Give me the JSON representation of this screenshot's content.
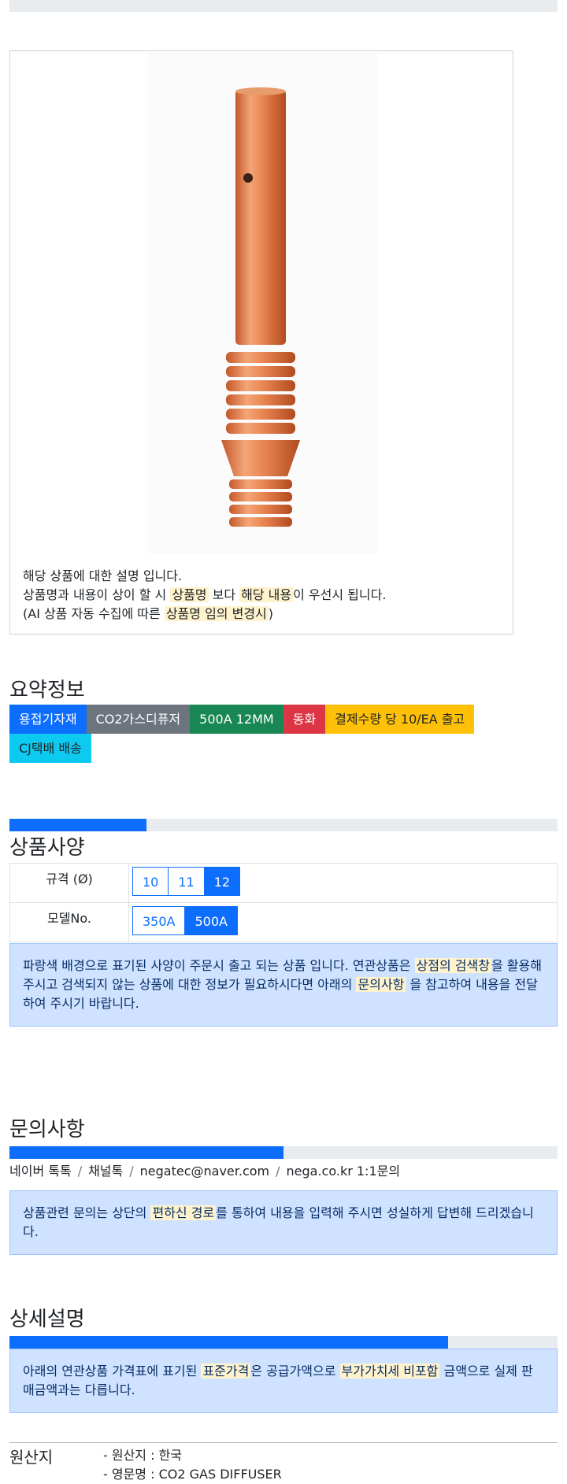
{
  "product_image": {
    "alt": "CO2 gas diffuser product photo"
  },
  "notice": {
    "line1": "해당 상품에 대한 설명 입니다.",
    "line2_a": "상품명과 내용이 상이 할 시 ",
    "line2_h1": "상품명",
    "line2_b": " 보다 ",
    "line2_h2": "해당 내용",
    "line2_c": "이 우선시 됩니다.",
    "line3_a": "(AI 상품 자동 수집에 따른 ",
    "line3_h": "상품명 임의 변경시",
    "line3_b": ")"
  },
  "summary": {
    "title": "요약정보",
    "tags": [
      {
        "label": "용접기자재",
        "color": "#0d6efd"
      },
      {
        "label": "CO2가스디퓨저",
        "color": "#6c757d"
      },
      {
        "label": "500A 12MM",
        "color": "#198754"
      },
      {
        "label": "동화",
        "color": "#dc3545"
      },
      {
        "label": "결제수량 당 10/EA 출고",
        "color": "#ffc107"
      },
      {
        "label": "CJ택배 배송",
        "color": "#0dcaf0"
      }
    ]
  },
  "spec": {
    "title": "상품사양",
    "progress_fraction": 0.25,
    "rows": [
      {
        "label": "규격 (Ø)",
        "options": [
          {
            "label": "10",
            "selected": false
          },
          {
            "label": "11",
            "selected": false
          },
          {
            "label": "12",
            "selected": true
          }
        ]
      },
      {
        "label": "모델No.",
        "options": [
          {
            "label": "350A",
            "selected": false
          },
          {
            "label": "500A",
            "selected": true
          }
        ]
      }
    ],
    "note_a": "파랑색 배경으로 표기된 사양이 주문시 출고 되는 상품 입니다. 연관상품은 ",
    "note_h1": "상점의 검색창",
    "note_b": "을 활용해 주시고 검색되지 않는 상품에 대한 정보가 필요하시다면 아래의 ",
    "note_h2": "문의사항",
    "note_c": " 을 참고하여 내용을 전달하여 주시기 바랍니다."
  },
  "inquiry": {
    "title": "문의사항",
    "progress_fraction": 0.5,
    "channels": [
      "네이버 톡톡",
      "채널톡",
      "negatec@naver.com",
      "nega.co.kr 1:1문의"
    ],
    "note_a": "상품관련 문의는 상단의 ",
    "note_h": "편하신 경로",
    "note_b": "를 통하여 내용을 입력해 주시면 성실하게 답변해 드리겠습니다."
  },
  "detail": {
    "title": "상세설명",
    "progress_fraction": 0.8,
    "note_a": "아래의 연관상품 가격표에 표기된 ",
    "note_h1": "표준가격",
    "note_b": "은 공급가액으로 ",
    "note_h2": "부가가치세 비포함",
    "note_c": " 금액으로 실제 판매금액과는 다릅니다."
  },
  "origin": {
    "title": "원산지",
    "items": [
      "- 원산지 : 한국",
      "- 영문명 : CO2 GAS DIFFUSER"
    ]
  }
}
